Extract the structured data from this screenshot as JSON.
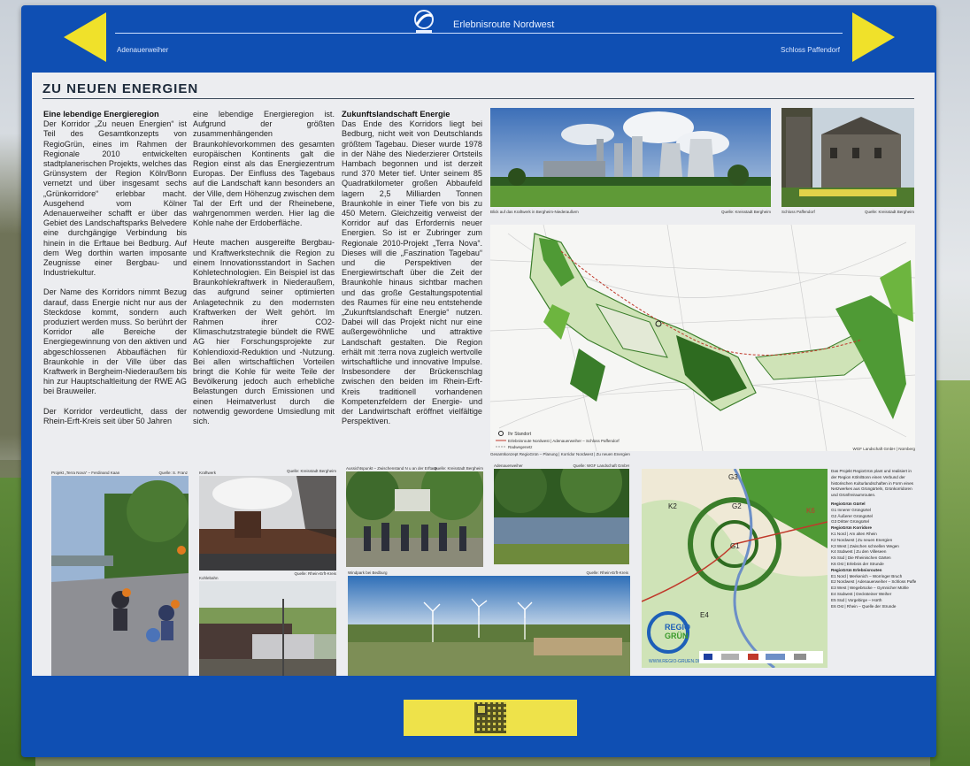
{
  "header": {
    "route_title": "Erlebnisroute Nordwest",
    "nav_left": "Adenauerweiher",
    "nav_right": "Schloss Paffendorf"
  },
  "page_title": "ZU NEUEN ENERGIEN",
  "text": {
    "col1_heading": "Eine lebendige Energieregion",
    "col1_p1": "Der Korridor „Zu neuen Energien“ ist Teil des Gesamtkonzepts von RegioGrün, eines im Rahmen der Regionale 2010 entwickelten stadtplanerischen Projekts, welches das Grünsystem der Region Köln/Bonn vernetzt und über insgesamt sechs „Grünkorridore“ erlebbar macht. Ausgehend vom Kölner Adenauerweiher schafft er über das Gebiet des Landschaftsparks Belvedere eine durchgängige Verbindung bis hinein in die Erftaue bei Bedburg. Auf dem Weg dorthin warten imposante Zeugnisse einer Bergbau- und Industriekultur.",
    "col1_p2": "Der Name des Korridors nimmt Bezug darauf, dass Energie nicht nur aus der Steckdose kommt, sondern auch produziert werden muss. So berührt der Korridor alle Bereiche der Energiegewinnung von den aktiven und abgeschlossenen Abbauflächen für Braunkohle in der Ville über das Kraftwerk in Bergheim-Niederaußem bis hin zur Hauptschaltleitung der RWE AG bei Brauweiler.",
    "col1_p3": "Der Korridor verdeutlicht, dass der Rhein-Erft-Kreis seit über 50 Jahren",
    "col2_p1": "eine lebendige Energieregion ist. Aufgrund der größten zusammenhängenden Braunkohlevorkommen des gesamten europäischen Kontinents galt die Region einst als das Energiezentrum Europas. Der Einfluss des Tagebaus auf die Landschaft kann besonders an der Ville, dem Höhenzug zwischen dem Tal der Erft und der Rheinebene, wahrgenommen werden. Hier lag die Kohle nahe der Erdoberfläche.",
    "col2_p2": "Heute machen ausgereifte Bergbau- und Kraftwerkstechnik die Region zu einem Innovationsstandort in Sachen Kohletechnologien. Ein Beispiel ist das Braunkohlekraftwerk in Niederaußem, das aufgrund seiner optimierten Anlagetechnik zu den modernsten Kraftwerken der Welt gehört. Im Rahmen ihrer CO2-Klimaschutzstrategie bündelt die RWE AG hier Forschungsprojekte zur Kohlendioxid-Reduktion und -Nutzung. Bei allen wirtschaftlichen Vorteilen bringt die Kohle für weite Teile der Bevölkerung jedoch auch erhebliche Belastungen durch Emissionen und einen Heimatverlust durch die notwendig gewordene Umsiedlung mit sich.",
    "col3_heading": "Zukunftslandschaft Energie",
    "col3_p1": "Das Ende des Korridors liegt bei Bedburg, nicht weit von Deutschlands größtem Tagebau. Dieser wurde 1978 in der Nähe des Niederzierer Ortsteils Hambach begonnen und ist derzeit rund 370 Meter tief. Unter seinem 85 Quadratkilometer großen Abbaufeld lagern 2,5 Milliarden Tonnen Braunkohle in einer Tiefe von bis zu 450 Metern. Gleichzeitig verweist der Korridor auf das Erfordernis neuer Energien. So ist er Zubringer zum Regionale 2010-Projekt „Terra Nova“. Dieses will die „Faszination Tagebau“ und die Perspektiven der Energiewirtschaft über die Zeit der Braunkohle hinaus sichtbar machen und das große Gestaltungspotential des Raumes für eine neu entstehende „Zukunftslandschaft Energie“ nutzen. Dabei will das Projekt nicht nur eine außergewöhnliche und attraktive Landschaft gestalten. Die Region erhält mit :terra nova zugleich wertvolle wirtschaftliche und innovative Impulse. Insbesondere der Brückenschlag zwischen den beiden im Rhein-Erft-Kreis traditionell vorhandenen Kompetenzfeldern der Energie- und der Landwirtschaft eröffnet vielfältige Perspektiven."
  },
  "captions": {
    "power_plant_left": "Blick auf das Kraftwerk in Bergheim-Niederaußem",
    "power_plant_right": "Quelle: Kreisstadt Bergheim",
    "castle_left": "Schloss Paffendorf",
    "castle_right": "Quelle: Kreisstadt Bergheim",
    "map_footer": "Gesamtkonzept RegioGrün – Planung | Korridor Nordwest | Zu neuen Energien",
    "map_credit": "WGF Landschaft GmbH | Nürnberg",
    "map_legend_1": "Ihr Standort",
    "map_legend_2": "Erlebnisroute Nordwest | Adenauerweiher – Schloss Paffendorf",
    "map_legend_3": "Radwegenetz",
    "cyclists_left": "Projekt „Terra Nova“ – Ferdinand Kaan",
    "cyclists_right": "Quelle: S. Franz",
    "plant2_left": "Kraftwerk",
    "plant2_right": "Quelle: Kreisstadt Bergheim",
    "group_left": "Aussichtspunkt – Zwischenstand N u an der Erftaue",
    "group_right": "Quelle: Kreisstadt Bergheim",
    "lake_left": "Adenauerweiher",
    "lake_right": "Quelle: WGF Landschaft GmbH",
    "train_left": "Kohlebahn",
    "train_right": "Quelle: Rhein-Erft-Kreis",
    "wind_left": "Windpark bei Bedburg",
    "wind_right": "Quelle: Rhein-Erft-Kreis",
    "regio_url": "WWW.REGIO-GRUEN.DE"
  },
  "legend": {
    "intro": "Das Projekt RegioGrün plant und realisiert in der Region Köln/Bonn einen Verbund der historischen Kulturlandschaften in Form eines Netzwerkes aus Grüngürteln, Grünkorridoren und Grünfreiraumrouten.",
    "group1": "RegioGrün Gürtel",
    "items1": [
      "G1 Innerer Grüngürtel",
      "G2 Äußerer Grüngürtel",
      "G3 Dritter Grüngürtel"
    ],
    "group2": "RegioGrün Korridore",
    "items2": [
      "K1 Nord | Am alten Rhein",
      "K2 Nordwest | Zu neuen Energien",
      "K3 West | Zwischen schnellen Wegen",
      "K4 Südwest | Zu den Villeseen",
      "K5 Süd | Die Rheinischen Gärten",
      "K6 Ost | Erlebnis der Strunde"
    ],
    "group3": "RegioGrün Erlebnisrouten",
    "items3": [
      "E1 Nord | Merkenich – Worringer Bruch",
      "E2 Nordwest | Adenauerweiher – Schloss Paffendorf",
      "E3 West | Wegebrücke – Gymnicher Mühle",
      "E4 Südwest | Decksteiner Weiher",
      "E5 Süd | Vorgebirge – Hürth",
      "E6 Ost | Rhein – Quelle der Strunde"
    ],
    "map_labels": [
      "G3",
      "G2",
      "G1",
      "K2",
      "K6",
      "E4"
    ]
  },
  "colors": {
    "board_blue": "#0f4fb3",
    "arrow_yellow": "#f0e12a",
    "panel_bg": "#ecedf0",
    "map_green": "#3a7d2a"
  }
}
